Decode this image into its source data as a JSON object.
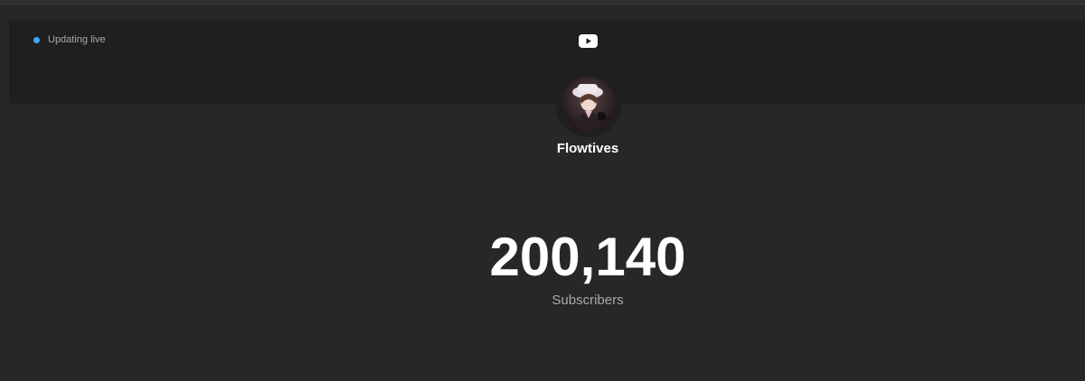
{
  "status": {
    "label": "Updating live",
    "dot_color": "#3ea6ff",
    "icon": "live-dot-icon"
  },
  "platform": {
    "icon": "youtube-play-icon"
  },
  "channel": {
    "name": "Flowtives",
    "avatar_icon": "channel-avatar"
  },
  "stats": {
    "subscriber_count": "200,140",
    "subscriber_label": "Subscribers"
  },
  "colors": {
    "background": "#272727",
    "banner": "#1f1f1f",
    "primary_text": "#ffffff",
    "secondary_text": "#aaaaaa"
  }
}
